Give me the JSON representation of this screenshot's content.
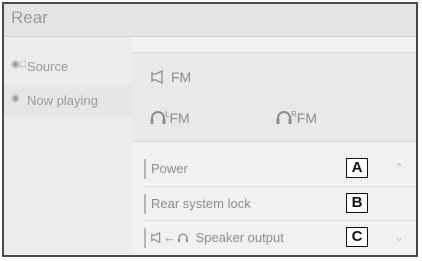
{
  "header": {
    "title": "Rear"
  },
  "sidebar": {
    "items": [
      {
        "label": "Source",
        "icon": "source-icon"
      },
      {
        "label": "Now playing",
        "icon": "play-icon"
      }
    ]
  },
  "sources": {
    "speaker": {
      "label": "FM",
      "icon": "speaker-icon"
    },
    "headphone_left": {
      "label": "FM",
      "icon": "headphone-icon",
      "channel": "L"
    },
    "headphone_right": {
      "label": "FM",
      "icon": "headphone-icon",
      "channel": "R"
    }
  },
  "settings": {
    "items": [
      {
        "label": "Power",
        "marker": "A"
      },
      {
        "label": "Rear system lock",
        "marker": "B"
      },
      {
        "label": "Speaker output",
        "marker": "C"
      }
    ]
  }
}
